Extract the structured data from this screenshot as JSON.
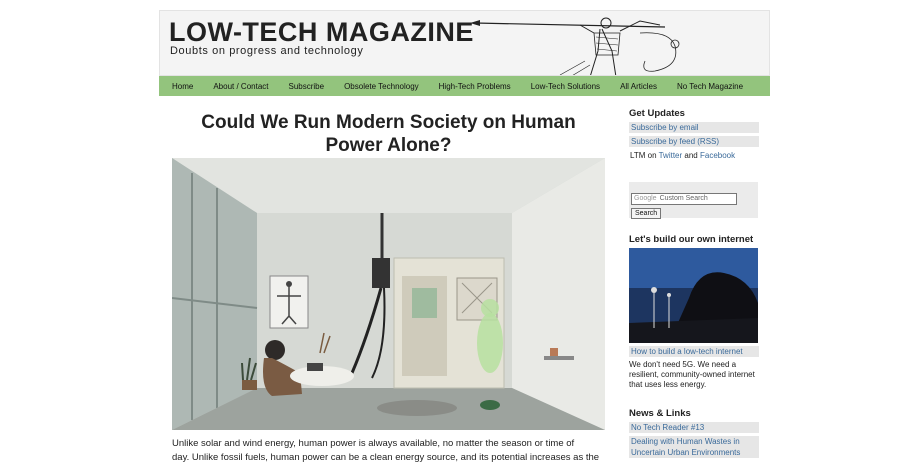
{
  "header": {
    "title": "LOW-TECH MAGAZINE",
    "tagline": "Doubts on progress and technology"
  },
  "nav": {
    "items": [
      "Home",
      "About / Contact",
      "Subscribe",
      "Obsolete Technology",
      "High-Tech Problems",
      "Low-Tech Solutions",
      "All Articles",
      "No Tech Magazine"
    ]
  },
  "article": {
    "title": "Could We Run Modern Society on Human Power Alone?",
    "body_line1": "Unlike solar and wind energy, human power is always available, no matter the season or time of",
    "body_line2": "day. Unlike fossil fuels, human power can be a clean energy source, and its potential increases as the"
  },
  "sidebar": {
    "updates_heading": "Get Updates",
    "subscribe_email": "Subscribe by email",
    "subscribe_feed": "Subscribe by feed (RSS)",
    "ltm_on": "LTM on",
    "twitter": "Twitter",
    "and": "and",
    "facebook": "Facebook",
    "search_brand": "Google",
    "search_placeholder": "Custom Search",
    "search_button": "Search",
    "internet_heading": "Let's build our own internet",
    "internet_link": "How to build a low-tech internet",
    "internet_desc": "We don't need 5G. We need a resilient, community-owned internet that uses less energy.",
    "news_heading": "News & Links",
    "news_items": [
      "No Tech Reader #13",
      "Dealing with Human Wastes in Uncertain Urban Environments"
    ]
  },
  "colors": {
    "nav_bg": "#93c47d",
    "link": "#3a6a9a",
    "sidebar_link_bg": "#e6e6e6"
  }
}
